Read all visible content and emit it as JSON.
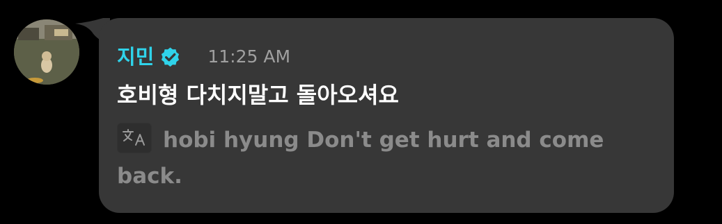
{
  "message": {
    "sender_name": "지민",
    "verified_icon": "verified-check-badge-icon",
    "time": "11:25 AM",
    "text": "호비형 다치지말고 돌아오셔요",
    "translate_icon": "translate-icon",
    "translation": "hobi hyung Don't get hurt and come back."
  },
  "colors": {
    "page_background": "#000000",
    "bubble_background": "#373737",
    "sender_name": "#2fd3ea",
    "verified_badge": "#2fd3ea",
    "time": "#a0a0a0",
    "message_text": "#ffffff",
    "translation_text": "#8b8b8b"
  }
}
